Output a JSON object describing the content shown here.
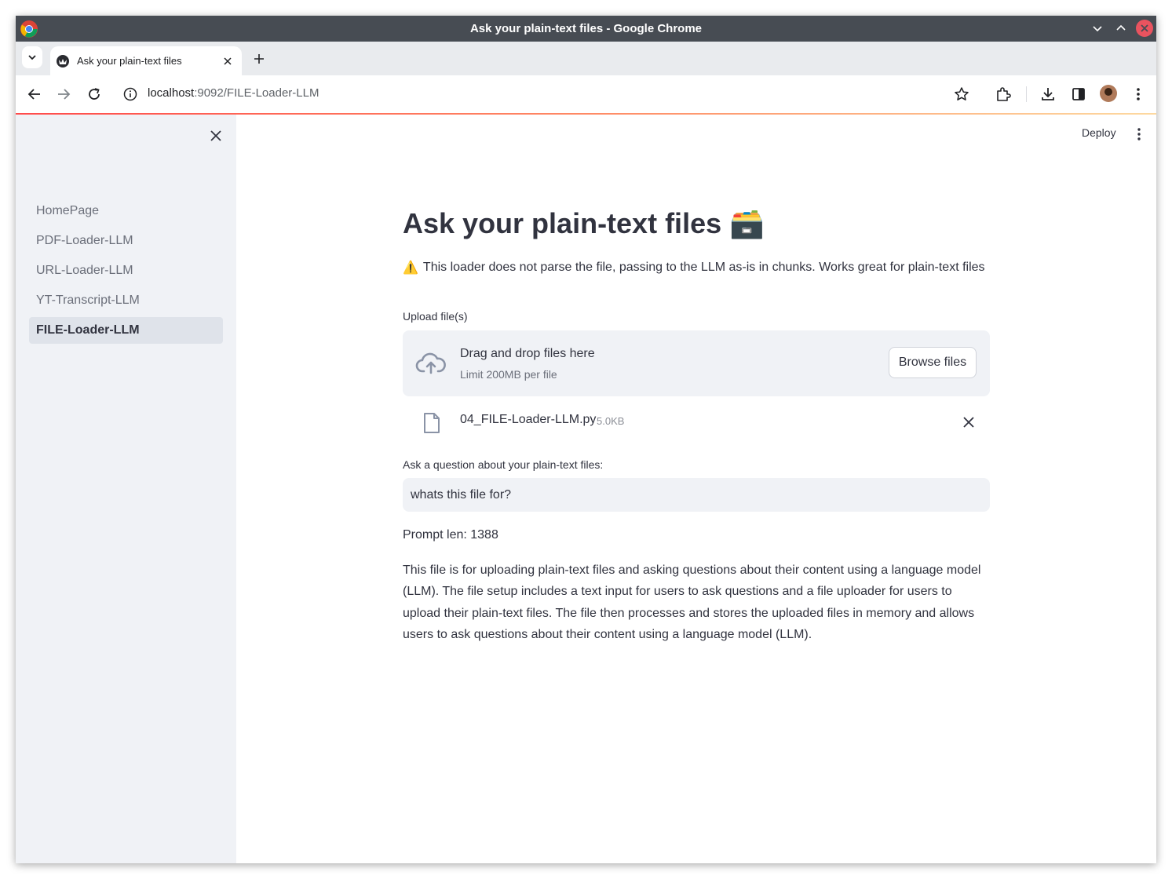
{
  "window": {
    "title": "Ask your plain-text files - Google Chrome"
  },
  "tab": {
    "title": "Ask your plain-text files"
  },
  "address_bar": {
    "host": "localhost",
    "rest": ":9092/FILE-Loader-LLM"
  },
  "sidebar": {
    "items": [
      {
        "label": "HomePage",
        "active": false
      },
      {
        "label": "PDF-Loader-LLM",
        "active": false
      },
      {
        "label": "URL-Loader-LLM",
        "active": false
      },
      {
        "label": "YT-Transcript-LLM",
        "active": false
      },
      {
        "label": "FILE-Loader-LLM",
        "active": true
      }
    ]
  },
  "header": {
    "deploy_label": "Deploy"
  },
  "main": {
    "title": "Ask your plain-text files",
    "title_emoji": "🗃️",
    "warning_emoji": "⚠️",
    "warning": "This loader does not parse the file, passing to the LLM as-is in chunks. Works great for plain-text files",
    "upload_label": "Upload file(s)",
    "dropzone_title": "Drag and drop files here",
    "dropzone_limit": "Limit 200MB per file",
    "browse_label": "Browse files",
    "file": {
      "name": "04_FILE-Loader-LLM.py",
      "size": "5.0KB"
    },
    "question_label": "Ask a question about your plain-text files:",
    "question_value": "whats this file for?",
    "prompt_len": "Prompt len: 1388",
    "answer": "This file is for uploading plain-text files and asking questions about their content using a language model (LLM). The file setup includes a text input for users to ask questions and a file uploader for users to upload their plain-text files. The file then processes and stores the uploaded files in memory and allows users to ask questions about their content using a language model (LLM)."
  },
  "colors": {
    "accent": "#ff4b4b",
    "sidebar_bg": "#f0f2f6",
    "titlebar_bg": "#474c53"
  }
}
